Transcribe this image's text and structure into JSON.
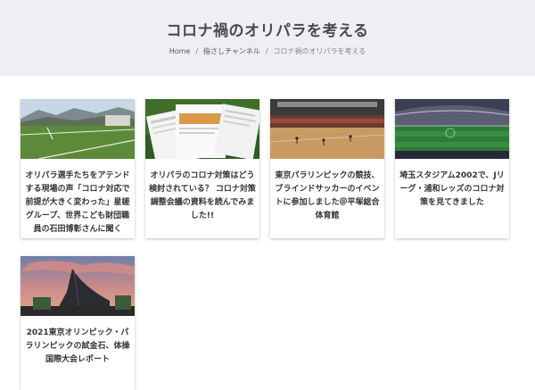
{
  "header": {
    "title": "コロナ禍のオリパラを考える",
    "breadcrumb": {
      "home": "Home",
      "sep": "/",
      "category": "指さしチャンネル",
      "current": "コロナ禍のオリパラを考える"
    }
  },
  "articles": [
    {
      "title": "オリパラ選手たちをアテンドする現場の声「コロナ対応で前提が大きく変わった」星槎グループ、世界こども財団職員の石田博彰さんに聞く"
    },
    {
      "title": "オリパラのコロナ対策はどう検討されている？ コロナ対策調整会議の資料を読んでみました!!"
    },
    {
      "title": "東京パラリンピックの競技、ブラインドサッカーのイベントに参加しました＠平塚総合体育館"
    },
    {
      "title": "埼玉スタジアム2002で、Jリーグ・浦和レッズのコロナ対策を見てきました"
    },
    {
      "title": "2021東京オリンピック・パラリンピックの試金石、体操国際大会レポート"
    }
  ]
}
